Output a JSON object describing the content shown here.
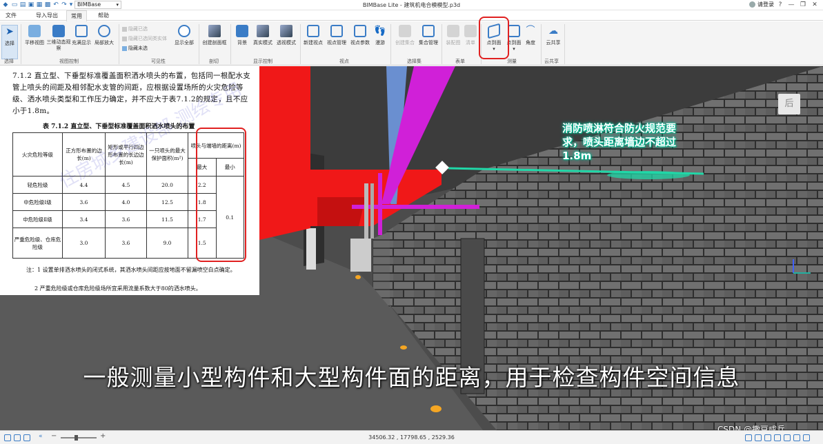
{
  "titlebar": {
    "doc_select": "BIMBase",
    "title": "BIMBase Lite - 建筑机电合模模型.p3d",
    "login": "请登录",
    "win_buttons": [
      "?",
      "—",
      "❐",
      "✕"
    ]
  },
  "tabs": [
    {
      "label": "文件",
      "active": false
    },
    {
      "label": "导入导出",
      "active": false
    },
    {
      "label": "常用",
      "active": true
    },
    {
      "label": "帮助",
      "active": false
    }
  ],
  "ribbon": {
    "buttons": [
      {
        "label": "选择"
      },
      {
        "label": "平移视图"
      },
      {
        "label": "三维动态观察"
      },
      {
        "label": "充满显示"
      },
      {
        "label": "局部放大"
      },
      {
        "label": "显示全部"
      },
      {
        "label": "创建剖面框"
      },
      {
        "label": "背景"
      },
      {
        "label": "真实模式"
      },
      {
        "label": "透视模式"
      },
      {
        "label": "新建视点"
      },
      {
        "label": "视点管理"
      },
      {
        "label": "视点参数"
      },
      {
        "label": "漫游"
      },
      {
        "label": "创建集合"
      },
      {
        "label": "集合管理"
      },
      {
        "label": "装配图"
      },
      {
        "label": "清单"
      },
      {
        "label": "点到面"
      },
      {
        "label": "点到面"
      },
      {
        "label": "角度"
      },
      {
        "label": "云共享"
      }
    ],
    "visibility_items": [
      "隐藏已选",
      "隐藏已选同类实体",
      "隐藏未选"
    ],
    "groups": [
      "选择",
      "视图控制",
      "可见性",
      "剖切",
      "显示控制",
      "视点",
      "选择集",
      "表单",
      "测量",
      "云共享"
    ]
  },
  "doc": {
    "para": "7.1.2 直立型、下垂型标准覆盖面积洒水喷头的布置，包括同一根配水支管上喷头的间距及相邻配水支管的间距，应根据设置场所的火灾危险等级、洒水喷头类型和工作压力确定，并不应大于表7.1.2的规定，且不应小于1.8m。",
    "table_caption": "表 7.1.2 直立型、下垂型标准覆盖面积洒水喷头的布置",
    "headers": [
      "火灾危险等级",
      "正方形布置的边长(m)",
      "矩形或平行四边形布置的长边边长(m)",
      "一只喷头的最大保护面积(m²)",
      "喷头与端墙的距离(m)",
      "最大",
      "最小"
    ],
    "rows": [
      [
        "轻危险级",
        "4.4",
        "4.5",
        "20.0",
        "2.2"
      ],
      [
        "中危险级Ⅰ级",
        "3.6",
        "4.0",
        "12.5",
        "1.8"
      ],
      [
        "中危险级Ⅱ级",
        "3.4",
        "3.6",
        "11.5",
        "1.7"
      ],
      [
        "严重危险级、仓库危险级",
        "3.0",
        "3.6",
        "9.0",
        "1.5"
      ]
    ],
    "min_value": "0.1",
    "notes": [
      "注：1 设置单排洒水喷头的闭式系统，其洒水喷头间距应按地面不留漏喷空白点确定。",
      "2 严重危险级或仓库危险级场所宜采用流量系数大于80的洒水喷头。"
    ],
    "watermark": "住房城乡建设部 测绘专用"
  },
  "viewport": {
    "annotation": [
      "消防喷淋符合防火规范要",
      "求，喷头距离墙边不超过",
      "1.8m"
    ],
    "back_label": "后",
    "caption": "一般测量小型构件和大型构件面的距离，用于检查构件空间信息",
    "watermark_csdn": "CSDN @撒豆成兵"
  },
  "status": {
    "coords": "34506.32 , 17798.65 , 2529.36"
  },
  "colors": {
    "pipe_magenta": "#d020d8",
    "duct_red": "#f01818",
    "pipe_blue": "#6a8fd0",
    "measure": "#20d8a8",
    "highlight": "#e02020"
  }
}
